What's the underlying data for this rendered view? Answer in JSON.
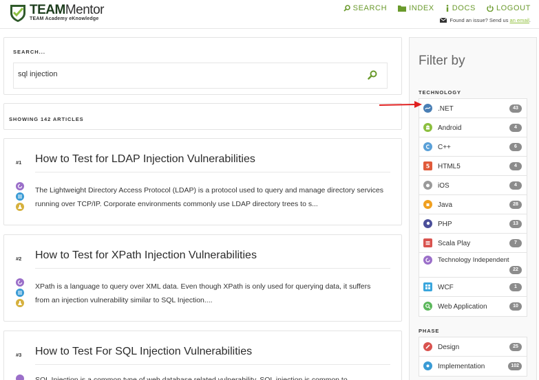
{
  "header": {
    "logo_title_bold": "TEAM",
    "logo_title_light": "Mentor",
    "logo_subtitle": "TEAM Academy eKnowledge",
    "nav": [
      {
        "label": "SEARCH",
        "icon": "search-icon"
      },
      {
        "label": "INDEX",
        "icon": "folder-icon"
      },
      {
        "label": "DOCS",
        "icon": "info-icon"
      },
      {
        "label": "LOGOUT",
        "icon": "power-icon"
      }
    ],
    "issue_text": "Found an issue? Send us",
    "issue_link": "an email",
    "issue_end": "."
  },
  "search": {
    "label": "SEARCH...",
    "value": "sql injection"
  },
  "results_count": "SHOWING 142 ARTICLES",
  "results": [
    {
      "num": "#1",
      "title": "How to Test for LDAP Injection Vulnerabilities",
      "desc": "The Lightweight Directory Access Protocol (LDAP) is a protocol used to query and manage directory services running over TCP/IP. Corporate environments commonly use LDAP directory trees to s..."
    },
    {
      "num": "#2",
      "title": "How to Test for XPath Injection Vulnerabilities",
      "desc": "XPath is a language to query over XML data. Even though XPath is only used for querying data, it suffers from an injection vulnerability similar to SQL Injection...."
    },
    {
      "num": "#3",
      "title": "How to Test For SQL Injection Vulnerabilities",
      "desc": "SQL Injection is a common type of web database related vulnerability. SQL injection is common to"
    }
  ],
  "filter": {
    "title": "Filter by",
    "technology_label": "TECHNOLOGY",
    "technology": [
      {
        "label": ".NET",
        "count": "43",
        "icon": "dotnet-icon",
        "color": "#4a7fb5"
      },
      {
        "label": "Android",
        "count": "4",
        "icon": "android-icon",
        "color": "#8cbf3f"
      },
      {
        "label": "C++",
        "count": "6",
        "icon": "cpp-icon",
        "color": "#5aa0d8"
      },
      {
        "label": "HTML5",
        "count": "4",
        "icon": "html5-icon",
        "color": "#e05a3a"
      },
      {
        "label": "iOS",
        "count": "4",
        "icon": "apple-icon",
        "color": "#9a9a9a"
      },
      {
        "label": "Java",
        "count": "28",
        "icon": "java-icon",
        "color": "#f0a020"
      },
      {
        "label": "PHP",
        "count": "13",
        "icon": "php-icon",
        "color": "#4b4f9a"
      },
      {
        "label": "Scala Play",
        "count": "7",
        "icon": "scala-icon",
        "color": "#d9534f"
      },
      {
        "label": "Technology Independent",
        "count": "22",
        "icon": "cycle-icon",
        "color": "#9b6fc9"
      },
      {
        "label": "WCF",
        "count": "1",
        "icon": "windows-icon",
        "color": "#3aa6dd"
      },
      {
        "label": "Web Application",
        "count": "10",
        "icon": "web-icon",
        "color": "#5cb85c"
      }
    ],
    "phase_label": "PHASE",
    "phase": [
      {
        "label": "Design",
        "count": "25",
        "icon": "design-icon",
        "color": "#d9534f"
      },
      {
        "label": "Implementation",
        "count": "102",
        "icon": "implementation-icon",
        "color": "#3a9bd5"
      }
    ]
  },
  "colors": {
    "accent_green": "#6a9a2c",
    "annotation_red": "#e02020"
  }
}
